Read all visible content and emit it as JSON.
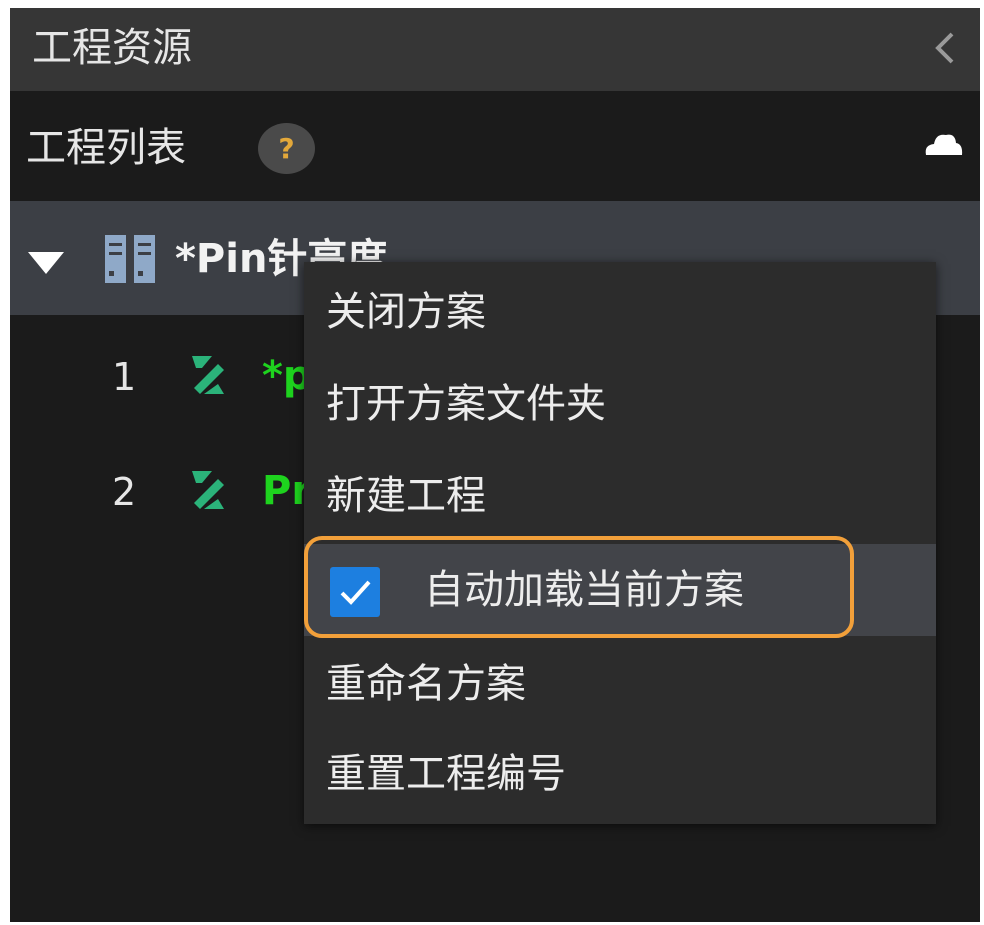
{
  "header": {
    "title": "工程资源",
    "collapse_icon": "chevron-left-icon"
  },
  "section": {
    "title": "工程列表",
    "help_label": "?",
    "cloud_icon": "cloud-icon"
  },
  "solution": {
    "name": "*Pin针高度",
    "expand_icon": "triangle-down-icon",
    "icon": "solution-columns-icon"
  },
  "projects": [
    {
      "index": "1",
      "name": "*p",
      "icon": "project-flow-icon"
    },
    {
      "index": "2",
      "name": "Pr",
      "icon": "project-flow-icon"
    }
  ],
  "context_menu": {
    "items": [
      {
        "label": "关闭方案"
      },
      {
        "label": "打开方案文件夹"
      },
      {
        "label": "新建工程"
      },
      {
        "label": "自动加载当前方案",
        "checked": true
      },
      {
        "label": "重命名方案"
      },
      {
        "label": "重置工程编号"
      }
    ]
  },
  "colors": {
    "panel_bg": "#1b1b1b",
    "header_bg": "#363636",
    "selected_row_bg": "#3c3f45",
    "menu_bg": "#2c2c2c",
    "menu_highlight_bg": "#424449",
    "project_green": "#1ed31e",
    "checkbox_blue": "#1d7fe0",
    "callout_orange": "#f2a03a",
    "help_icon_gold": "#e3a83a"
  }
}
